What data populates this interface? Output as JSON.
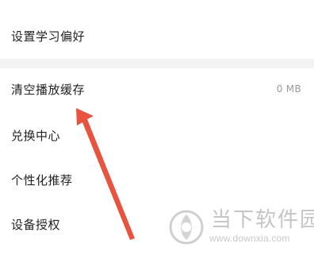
{
  "settings": {
    "items": [
      {
        "label": "设置学习偏好",
        "value": ""
      },
      {
        "label": "清空播放缓存",
        "value": "0 MB"
      },
      {
        "label": "兑换中心",
        "value": ""
      },
      {
        "label": "个性化推荐",
        "value": ""
      },
      {
        "label": "设备授权",
        "value": ""
      }
    ]
  },
  "annotation": {
    "arrow_color": "#e8533f",
    "arrow_target": "清空播放缓存"
  },
  "watermark": {
    "title": "当下软件园",
    "url": "www.downxia.com",
    "color": "#c5c5c5",
    "logo_icon": "downxia-logo-icon"
  }
}
